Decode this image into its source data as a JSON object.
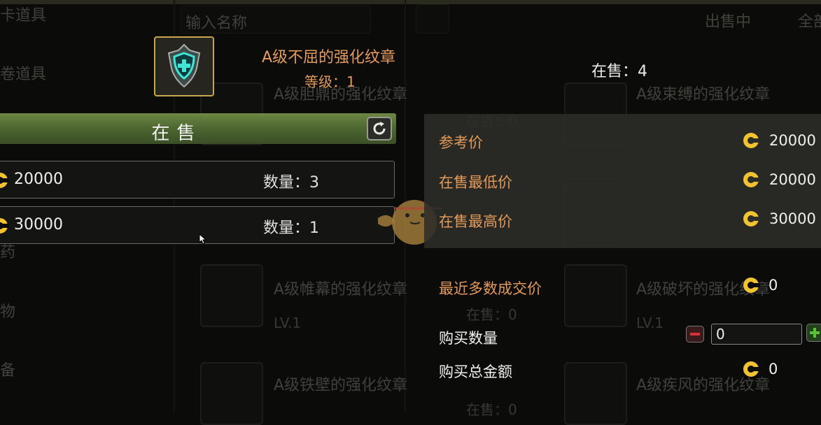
{
  "background": {
    "search_placeholder": "输入名称",
    "filter_tab": "出售中",
    "filter_all": "全部",
    "left_menu": [
      "卡道具",
      "卷道具",
      "药",
      "物",
      "备"
    ],
    "items": [
      {
        "name": "A级胆鼎的强化纹章",
        "onsale": "在售：0"
      },
      {
        "name": "A级束缚的强化纹章",
        "onsale": ""
      },
      {
        "name": "A级帷幕的强化纹章",
        "onsale": "在售：0",
        "level": "LV.1"
      },
      {
        "name": "A级破坏的强化纹章",
        "onsale": "",
        "level": "LV.1"
      },
      {
        "name": "A级铁壁的强化纹章",
        "onsale": "在售：0"
      },
      {
        "name": "A级疾风的强化纹章",
        "onsale": ""
      }
    ]
  },
  "item": {
    "name": "A级不屈的强化纹章",
    "level": "等级：1",
    "icon": "emblem-shield-icon",
    "onsale_count": "在售：4"
  },
  "listing": {
    "header": "在售",
    "rows": [
      {
        "price": "20000",
        "qty": "数量：3"
      },
      {
        "price": "30000",
        "qty": "数量：1"
      }
    ]
  },
  "prices": {
    "reference_label": "参考价",
    "reference_value": "20000",
    "lowest_label": "在售最低价",
    "lowest_value": "20000",
    "highest_label": "在售最高价",
    "highest_value": "30000",
    "recent_label": "最近多数成交价",
    "recent_value": "0"
  },
  "purchase": {
    "qty_label": "购买数量",
    "qty_value": "0",
    "total_label": "购买总金额",
    "total_value": "0"
  },
  "colors": {
    "accent": "#e39a5a",
    "coin": "#f2c230",
    "header_green": "#4a6330"
  }
}
